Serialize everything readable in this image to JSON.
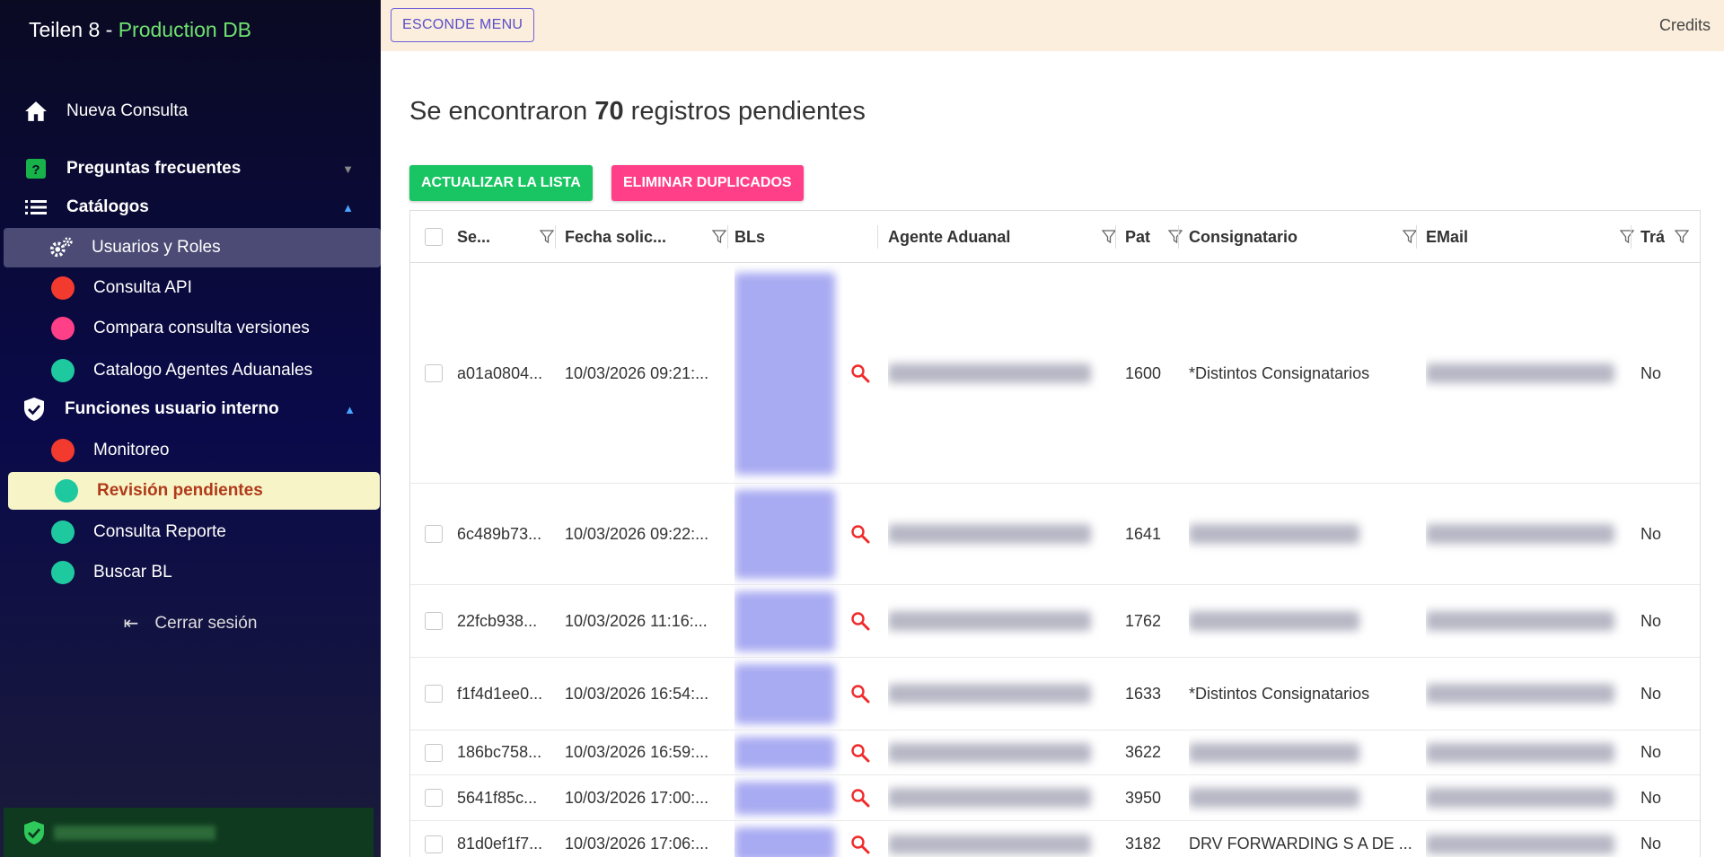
{
  "app": {
    "title": "Teilen 8 - ",
    "env": "Production DB"
  },
  "sidebar": {
    "nueva_consulta": "Nueva Consulta",
    "preguntas": "Preguntas frecuentes",
    "catalogos": "Catálogos",
    "catalog_items": [
      "Usuarios y Roles",
      "Consulta API",
      "Compara consulta versiones",
      "Catalogo Agentes Aduanales"
    ],
    "funciones": "Funciones usuario interno",
    "funcion_items": [
      "Monitoreo",
      "Revisión pendientes",
      "Consulta Reporte",
      "Buscar BL"
    ],
    "logout": "Cerrar sesión"
  },
  "topbar": {
    "hide_menu": "ESCONDE MENU",
    "credits": "Credits"
  },
  "main": {
    "heading_pre": "Se encontraron ",
    "heading_count": "70",
    "heading_post": " registros pendientes",
    "refresh_button": "ACTUALIZAR LA LISTA",
    "dedupe_button": "ELIMINAR DUPLICADOS"
  },
  "table": {
    "columns": [
      "Se...",
      "Fecha solic...",
      "BLs",
      "Agente Aduanal",
      "Pat",
      "Consignatario",
      "EMail",
      "Trá"
    ],
    "rows": [
      {
        "id": "a01a0804...",
        "fecha": "10/03/2026 09:21:...",
        "pat": "1600",
        "consignatario": "*Distintos Consignatarios",
        "tra": "No"
      },
      {
        "id": "6c489b73...",
        "fecha": "10/03/2026 09:22:...",
        "pat": "1641",
        "consignatario": "",
        "tra": "No"
      },
      {
        "id": "22fcb938...",
        "fecha": "10/03/2026 11:16:...",
        "pat": "1762",
        "consignatario": "",
        "tra": "No"
      },
      {
        "id": "f1f4d1ee0...",
        "fecha": "10/03/2026 16:54:...",
        "pat": "1633",
        "consignatario": "*Distintos Consignatarios",
        "tra": "No"
      },
      {
        "id": "186bc758...",
        "fecha": "10/03/2026 16:59:...",
        "pat": "3622",
        "consignatario": "",
        "tra": "No"
      },
      {
        "id": "5641f85c...",
        "fecha": "10/03/2026 17:00:...",
        "pat": "3950",
        "consignatario": "",
        "tra": "No"
      },
      {
        "id": "81d0ef1f7...",
        "fecha": "10/03/2026 17:06:...",
        "pat": "3182",
        "consignatario": "DRV FORWARDING S A DE ...",
        "tra": "No"
      }
    ]
  },
  "colors": {
    "accent_green": "#19c463",
    "accent_pink": "#ff3f88",
    "env_green": "#6fe36f"
  }
}
